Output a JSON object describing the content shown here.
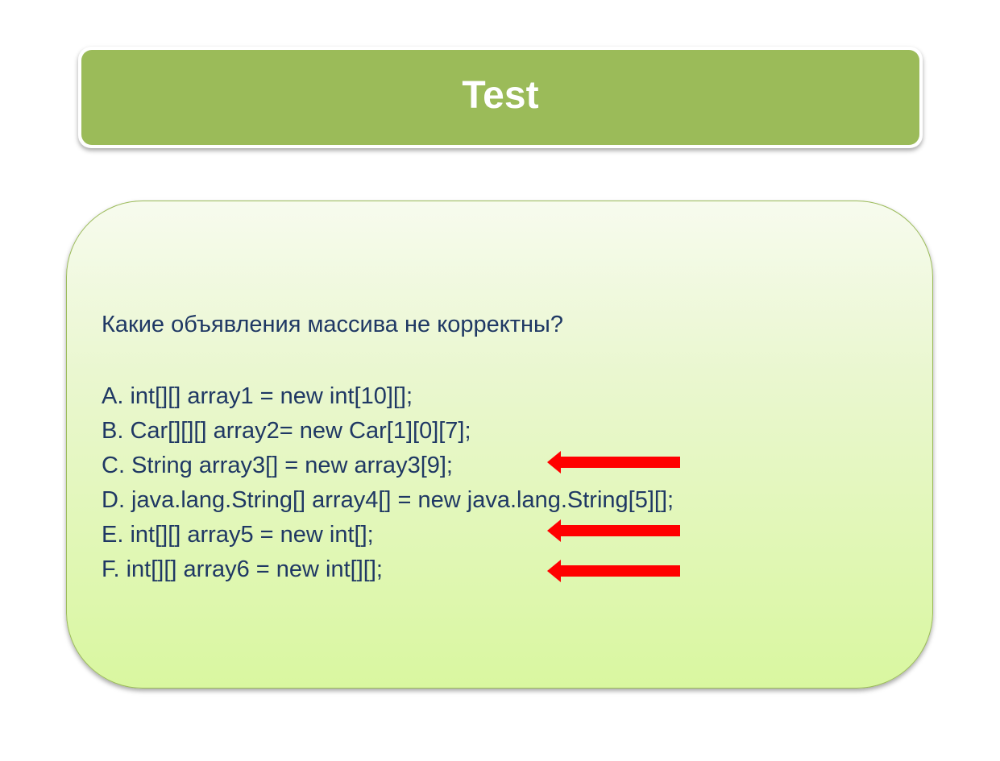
{
  "slide": {
    "title": "Test",
    "question": "Какие объявления массива не корректны?",
    "options": [
      {
        "text": "A. int[][] array1 = new int[10][];",
        "marked": false
      },
      {
        "text": "B. Car[][][] array2= new Car[1][0][7];",
        "marked": false
      },
      {
        "text": "C. String array3[] = new array3[9];",
        "marked": true
      },
      {
        "text": "D. java.lang.String[] array4[] = new java.lang.String[5][];",
        "marked": false
      },
      {
        "text": "E. int[][] array5 = new int[];",
        "marked": true
      },
      {
        "text": "F. int[][] array6 = new int[][];",
        "marked": true
      }
    ]
  },
  "colors": {
    "title_background": "#9bbb59",
    "title_text": "#ffffff",
    "body_text": "#1f3864",
    "arrow": "#ff0000",
    "content_gradient_bottom": "#d9f7a0"
  },
  "icons": {
    "marker": "left-arrow-icon"
  }
}
